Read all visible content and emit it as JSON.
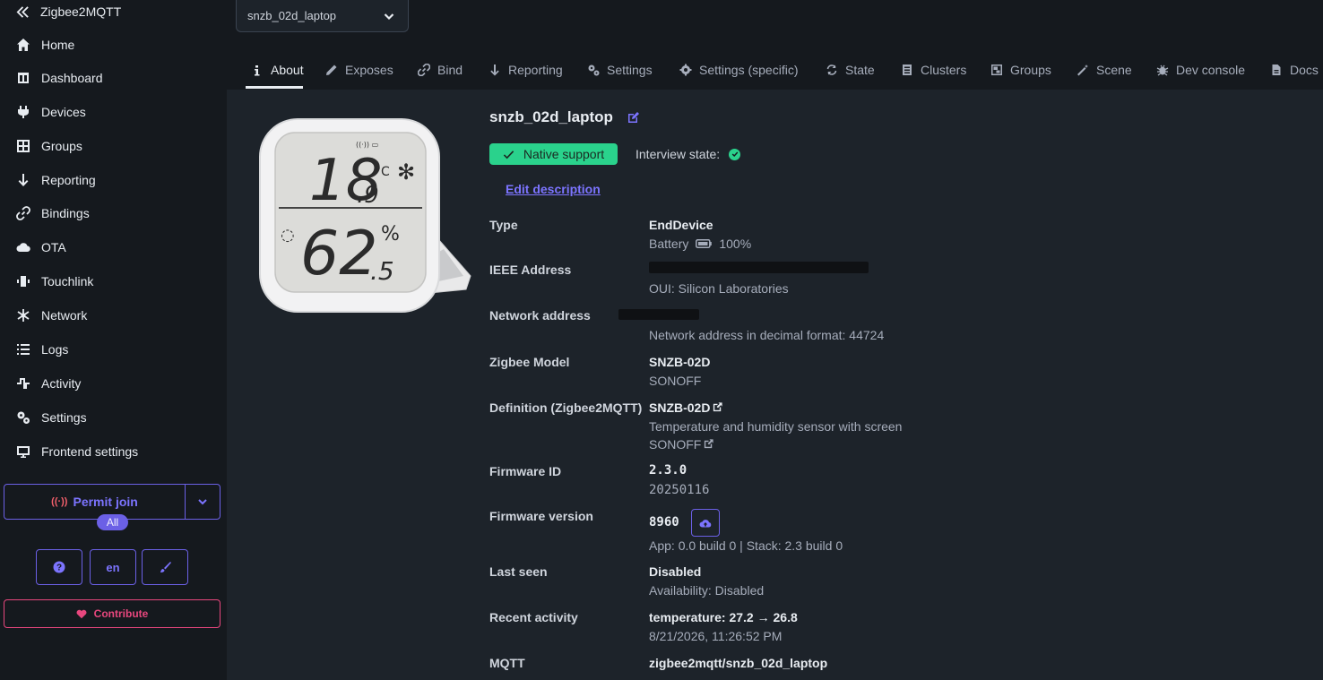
{
  "app": {
    "title": "Zigbee2MQTT"
  },
  "sidebar": {
    "items": [
      {
        "label": "Home",
        "icon": "home-icon"
      },
      {
        "label": "Dashboard",
        "icon": "dashboard-icon"
      },
      {
        "label": "Devices",
        "icon": "plug-icon"
      },
      {
        "label": "Groups",
        "icon": "groups-icon"
      },
      {
        "label": "Reporting",
        "icon": "arrow-down-icon"
      },
      {
        "label": "Bindings",
        "icon": "link-icon"
      },
      {
        "label": "OTA",
        "icon": "cloud-icon"
      },
      {
        "label": "Touchlink",
        "icon": "touchlink-icon"
      },
      {
        "label": "Network",
        "icon": "network-icon"
      },
      {
        "label": "Logs",
        "icon": "list-icon"
      },
      {
        "label": "Activity",
        "icon": "activity-icon"
      },
      {
        "label": "Settings",
        "icon": "settings-icon"
      },
      {
        "label": "Frontend settings",
        "icon": "monitor-icon"
      }
    ],
    "permit_join": "Permit join",
    "permit_scope": "All",
    "language": "en",
    "contribute": "Contribute"
  },
  "device_select": {
    "value": "snzb_02d_laptop"
  },
  "tabs": [
    {
      "label": "About",
      "icon": "info-icon",
      "active": true
    },
    {
      "label": "Exposes",
      "icon": "pencil-icon"
    },
    {
      "label": "Bind",
      "icon": "link-icon"
    },
    {
      "label": "Reporting",
      "icon": "arrow-down-icon"
    },
    {
      "label": "Settings",
      "icon": "cogs-icon"
    },
    {
      "label": "Settings (specific)",
      "icon": "cog-icon"
    },
    {
      "label": "State",
      "icon": "refresh-icon"
    },
    {
      "label": "Clusters",
      "icon": "server-icon"
    },
    {
      "label": "Groups",
      "icon": "object-group-icon"
    },
    {
      "label": "Scene",
      "icon": "magic-wand-icon"
    },
    {
      "label": "Dev console",
      "icon": "bug-icon"
    },
    {
      "label": "Docs",
      "icon": "document-icon"
    }
  ],
  "device": {
    "name": "snzb_02d_laptop",
    "support": "Native support",
    "interview_label": "Interview state:",
    "edit_description": "Edit description",
    "image": {
      "temp_main": "18",
      "temp_dec": ".9",
      "temp_unit": "°C",
      "hum_main": "62",
      "hum_dec": ".5",
      "hum_unit": "%"
    },
    "rows": {
      "type": {
        "label": "Type",
        "value": "EndDevice",
        "sub": "Battery",
        "battery": "100%"
      },
      "ieee": {
        "label": "IEEE Address",
        "sub": "OUI: Silicon Laboratories"
      },
      "network": {
        "label": "Network address",
        "sub": "Network address in decimal format: 44724"
      },
      "model": {
        "label": "Zigbee Model",
        "value": "SNZB-02D",
        "sub": "SONOFF"
      },
      "definition": {
        "label": "Definition (Zigbee2MQTT)",
        "value": "SNZB-02D",
        "sub": "Temperature and humidity sensor with screen",
        "vendor": "SONOFF"
      },
      "firmware_id": {
        "label": "Firmware ID",
        "value": "2.3.0",
        "sub": "20250116"
      },
      "firmware_version": {
        "label": "Firmware version",
        "value": "8960",
        "sub": "App: 0.0 build 0 | Stack: 2.3 build 0"
      },
      "last_seen": {
        "label": "Last seen",
        "value": "Disabled",
        "sub": "Availability: Disabled"
      },
      "recent": {
        "label": "Recent activity",
        "value": "temperature: 27.2 → 26.8",
        "sub": "8/21/2026, 11:26:52 PM"
      },
      "mqtt": {
        "label": "MQTT",
        "value": "zigbee2mqtt/snzb_02d_laptop"
      }
    }
  },
  "colors": {
    "accent": "#6b60e6",
    "success": "#2ad28c",
    "contribute": "#e8477e",
    "sidebar_bg": "#15191e",
    "main_bg": "#1d232a"
  }
}
